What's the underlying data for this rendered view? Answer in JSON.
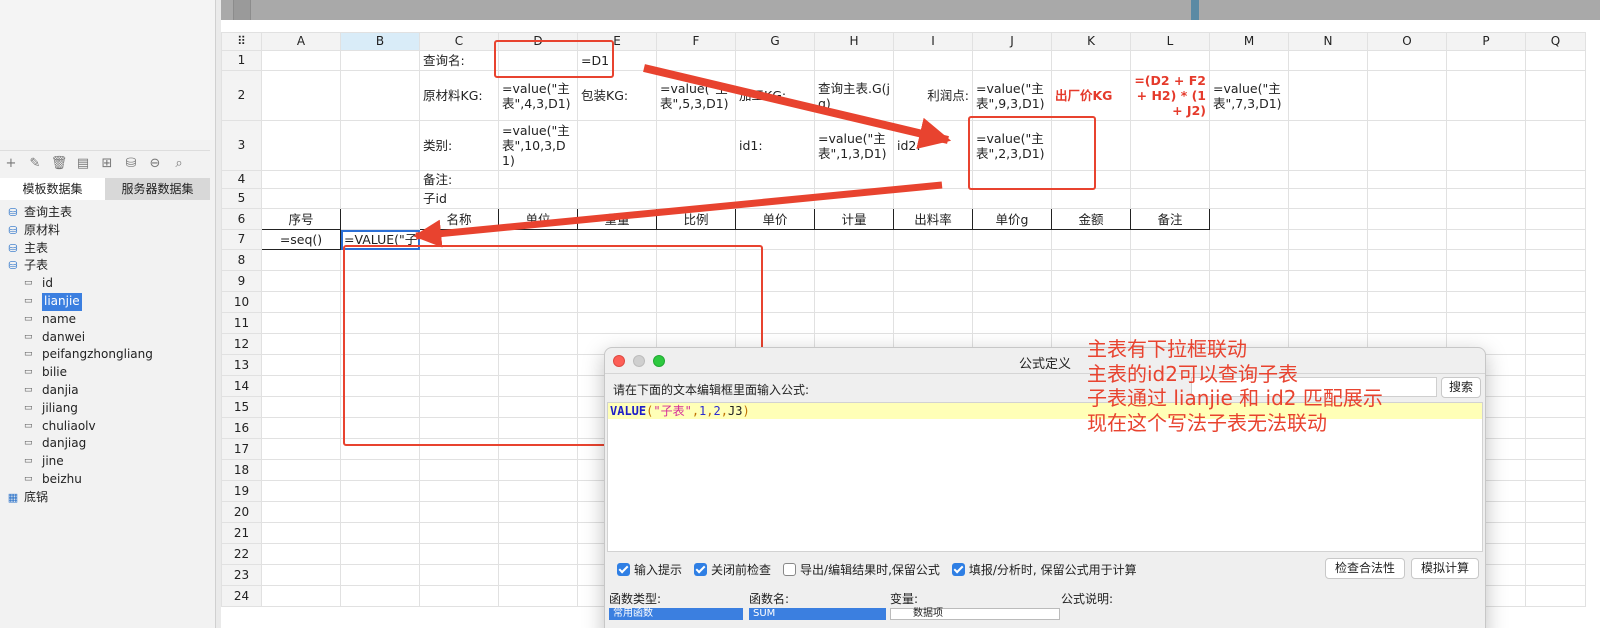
{
  "left_panel": {
    "tabs": [
      "模板数据集",
      "服务器数据集"
    ],
    "toolbar_icons": [
      "add-icon",
      "edit-icon",
      "delete-icon",
      "preview-icon",
      "properties-icon",
      "database-icon",
      "database-remove-icon",
      "search-icon"
    ],
    "tree": [
      {
        "label": "查询主表",
        "level": 0,
        "icon": "database-icon"
      },
      {
        "label": "原材料",
        "level": 0,
        "icon": "database-icon"
      },
      {
        "label": "主表",
        "level": 0,
        "icon": "database-icon"
      },
      {
        "label": "子表",
        "level": 0,
        "icon": "database-icon"
      },
      {
        "label": "id",
        "level": 1,
        "icon": "field-icon"
      },
      {
        "label": "lianjie",
        "level": 1,
        "icon": "field-icon",
        "selected": true
      },
      {
        "label": "name",
        "level": 1,
        "icon": "field-icon"
      },
      {
        "label": "danwei",
        "level": 1,
        "icon": "field-icon"
      },
      {
        "label": "peifangzhongliang",
        "level": 1,
        "icon": "field-icon"
      },
      {
        "label": "bilie",
        "level": 1,
        "icon": "field-icon"
      },
      {
        "label": "danjia",
        "level": 1,
        "icon": "field-icon"
      },
      {
        "label": "jiliang",
        "level": 1,
        "icon": "field-icon"
      },
      {
        "label": "chuliaolv",
        "level": 1,
        "icon": "field-icon"
      },
      {
        "label": "danjiag",
        "level": 1,
        "icon": "field-icon"
      },
      {
        "label": "jine",
        "level": 1,
        "icon": "field-icon"
      },
      {
        "label": "beizhu",
        "level": 1,
        "icon": "field-icon"
      },
      {
        "label": "底锅",
        "level": 0,
        "icon": "table-icon"
      }
    ]
  },
  "sheet": {
    "corner": "⠿",
    "columns": [
      "A",
      "B",
      "C",
      "D",
      "E",
      "F",
      "G",
      "H",
      "I",
      "J",
      "K",
      "L",
      "M",
      "N",
      "O",
      "P",
      "Q"
    ],
    "rows": [
      "1",
      "2",
      "3",
      "4",
      "5",
      "6",
      "7",
      "8",
      "9",
      "10",
      "11",
      "12",
      "13",
      "14",
      "15",
      "16",
      "17",
      "18",
      "19",
      "20",
      "21",
      "22",
      "23",
      "24"
    ],
    "cells": {
      "C1": "查询名:",
      "E1": "=D1",
      "C2": "原材料KG:",
      "D2": "=value(\"主表\",4,3,D1)",
      "E2": "包装KG:",
      "F2": "=value(\"主表\",5,3,D1)",
      "G2": "加工KG:",
      "H2": "查询主表.G(jg)",
      "I2": "利润点:",
      "J2": "=value(\"主表\",9,3,D1)",
      "K2": "出厂价KG",
      "L2": "=(D2 + F2 + H2) * (1 + J2)",
      "M2": "=value(\"主表\",7,3,D1)",
      "C3": "类别:",
      "D3": "=value(\"主表\",10,3,D1)",
      "G3": "id1:",
      "H3": "=value(\"主表\",1,3,D1)",
      "I3": "id2:",
      "J3": "=value(\"主表\",2,3,D1)",
      "C4": "备注:",
      "C5": "子id",
      "A6": "序号",
      "C6": "名称",
      "D6": "单位",
      "E6": "重量",
      "F6": "比例",
      "G6": "单价",
      "H6": "计量",
      "I6": "出料率",
      "J6": "单价g",
      "K6": "金额",
      "L6": "备注",
      "A7": "=seq()",
      "B7": "=VALUE(\"子"
    }
  },
  "dialog": {
    "title": "公式定义",
    "prompt": "请在下面的文本编辑框里面输入公式:",
    "search_button": "搜索",
    "formula": {
      "fn": "VALUE",
      "open": "(",
      "str": "\"子表\"",
      "c1": ",",
      "n1": "1",
      "c2": ",",
      "n2": "2",
      "c3": ",",
      "ref": "J3",
      "close": ")"
    },
    "options": [
      {
        "label": "输入提示",
        "checked": true
      },
      {
        "label": "关闭前检查",
        "checked": true
      },
      {
        "label": "导出/编辑结果时,保留公式",
        "checked": false
      },
      {
        "label": "填报/分析时, 保留公式用于计算",
        "checked": true
      }
    ],
    "check_button": "检查合法性",
    "simulate_button": "模拟计算",
    "lower_labels": [
      "函数类型:",
      "函数名:",
      "变量:",
      "公式说明:"
    ],
    "lower_values": [
      "常用函数",
      "SUM",
      "数据项"
    ]
  },
  "annotation": {
    "lines": [
      "主表有下拉框联动",
      "主表的id2可以查询子表",
      "子表通过 lianjie 和 id2 匹配展示",
      "现在这个写法子表无法联动"
    ],
    "color": "#e8432f"
  }
}
